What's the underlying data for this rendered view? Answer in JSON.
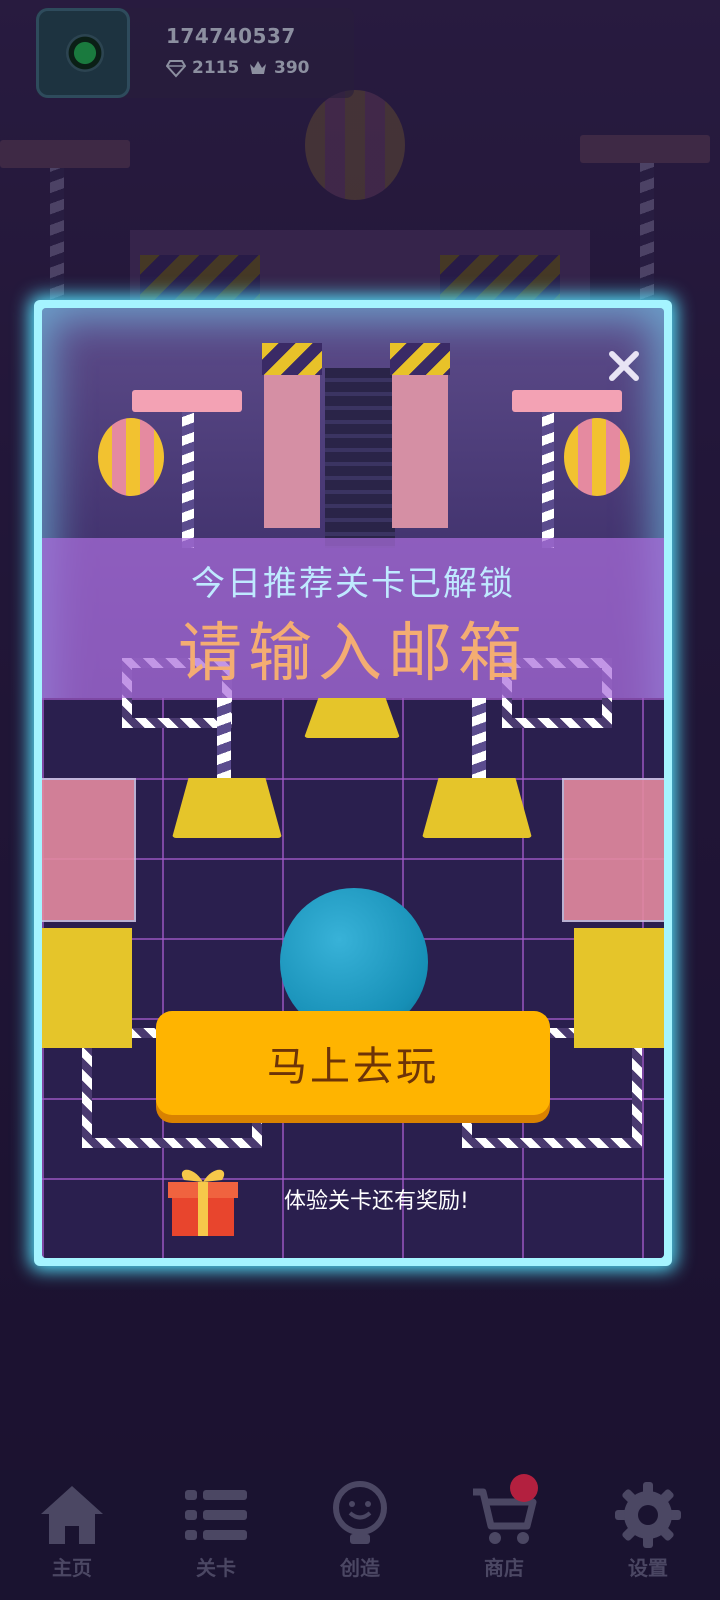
{
  "profile": {
    "user_id": "174740537",
    "diamonds": "2115",
    "crowns": "390"
  },
  "popup": {
    "subtitle": "今日推荐关卡已解锁",
    "title": "请输入邮箱",
    "play_button": "马上去玩",
    "reward_text": "体验关卡还有奖励!"
  },
  "nav": {
    "items": [
      {
        "label": "主页",
        "icon": "home-icon"
      },
      {
        "label": "关卡",
        "icon": "list-icon"
      },
      {
        "label": "创造",
        "icon": "lightbulb-icon"
      },
      {
        "label": "商店",
        "icon": "cart-icon",
        "badge": true
      },
      {
        "label": "设置",
        "icon": "gear-icon"
      }
    ]
  },
  "colors": {
    "accent_button": "#ffb400",
    "popup_glow": "#55e6ff",
    "title_text": "#f4ad72",
    "subtitle_text": "#bfe9ff",
    "badge": "#b3203f"
  }
}
